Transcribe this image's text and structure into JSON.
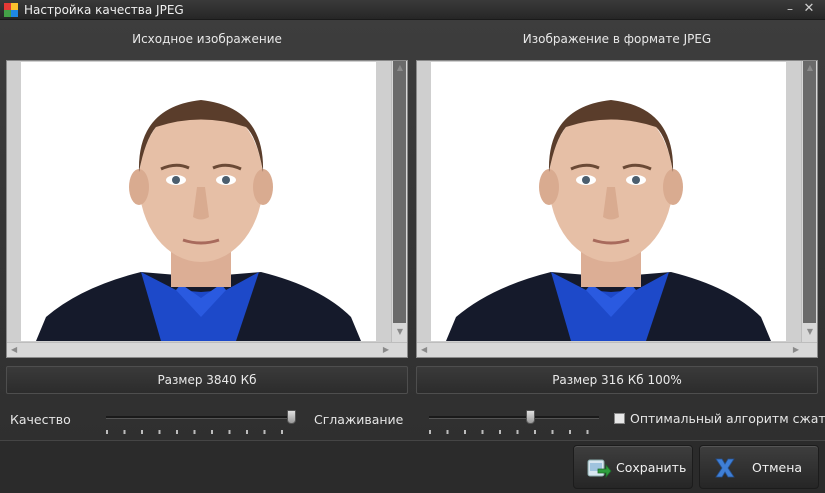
{
  "window": {
    "title": "Настройка качества JPEG",
    "minimize_glyph": "–",
    "close_glyph": "✕"
  },
  "panels": {
    "original": {
      "caption": "Исходное изображение",
      "size_text": "Размер 3840 Кб"
    },
    "jpeg": {
      "caption": "Изображение в формате JPEG",
      "size_text": "Размер 316 Кб 100%"
    }
  },
  "controls": {
    "quality_label": "Качество",
    "quality_value": 1.0,
    "smoothing_label": "Сглаживание",
    "smoothing_value": 0.6,
    "optimal_label": "Оптимальный алгоритм сжатия",
    "optimal_checked": false
  },
  "buttons": {
    "save_label": "Сохранить",
    "cancel_label": "Отмена"
  },
  "icons": {
    "app": "app-logo-icon",
    "save": "save-export-icon",
    "cancel": "cancel-x-icon"
  },
  "colors": {
    "save_accent": "#2e9e3e",
    "cancel_accent": "#3f7fd6"
  }
}
